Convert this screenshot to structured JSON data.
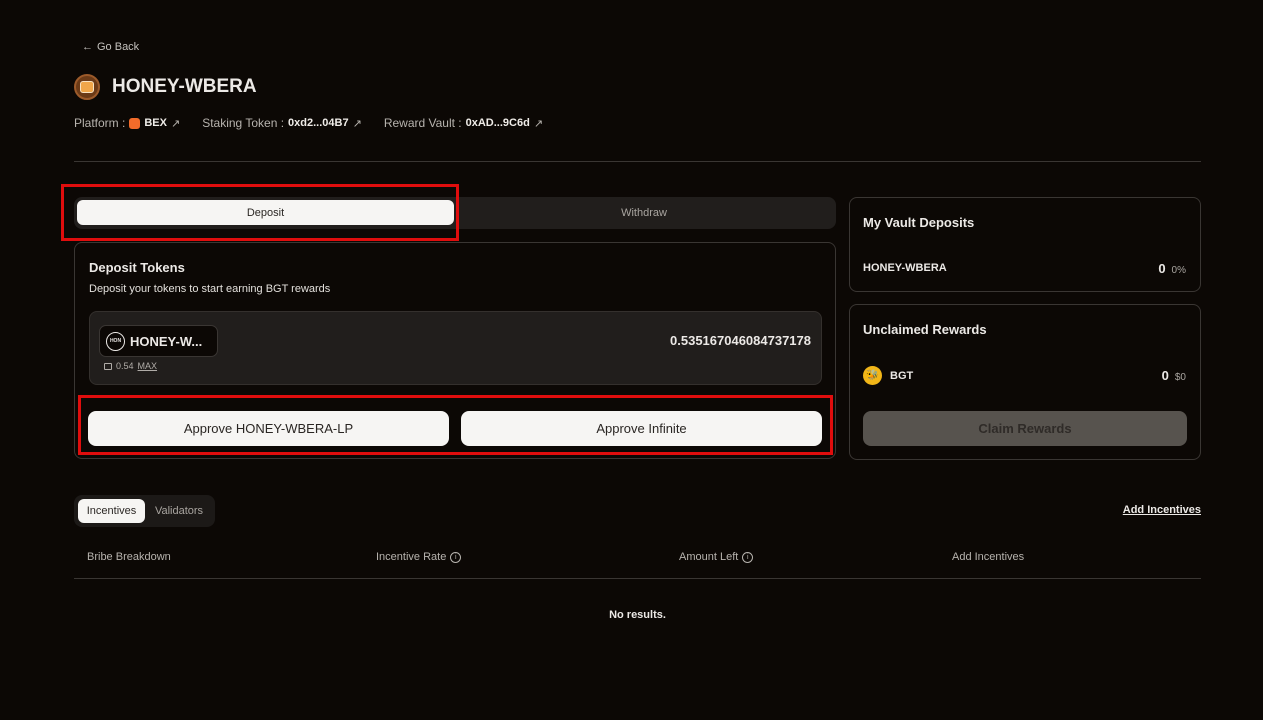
{
  "nav": {
    "go_back": "Go Back",
    "back_arrow": "←"
  },
  "header": {
    "title": "HONEY-WBERA",
    "platform_label": "Platform :",
    "platform_value": "BEX",
    "staking_token_label": "Staking Token :",
    "staking_token_value": "0xd2...04B7",
    "reward_vault_label": "Reward Vault :",
    "reward_vault_value": "0xAD...9C6d",
    "external_link_glyph": "↗"
  },
  "action_tabs": [
    {
      "label": "Deposit",
      "active": true
    },
    {
      "label": "Withdraw",
      "active": false
    }
  ],
  "deposit_card": {
    "title": "Deposit Tokens",
    "subtitle": "Deposit your tokens to start earning BGT rewards",
    "token_icon_text": "HON",
    "token_name": "HONEY-W...",
    "balance": "0.54",
    "max_label": "MAX",
    "amount": "0.535167046084737178",
    "approve_button": "Approve HONEY-WBERA-LP",
    "approve_infinite_button": "Approve Infinite"
  },
  "vault_deposits": {
    "title": "My Vault Deposits",
    "token": "HONEY-WBERA",
    "amount": "0",
    "percent": "0%"
  },
  "unclaimed_rewards": {
    "title": "Unclaimed Rewards",
    "token": "BGT",
    "token_icon": "🐝",
    "amount": "0",
    "usd": "$0",
    "claim_button": "Claim Rewards"
  },
  "bottom_tabs": [
    {
      "label": "Incentives",
      "active": true
    },
    {
      "label": "Validators",
      "active": false
    }
  ],
  "add_incentives_link": "Add Incentives",
  "table": {
    "columns": [
      "Bribe Breakdown",
      "Incentive Rate",
      "Amount Left",
      "Add Incentives"
    ],
    "info_glyph": "i",
    "empty_text": "No results."
  }
}
